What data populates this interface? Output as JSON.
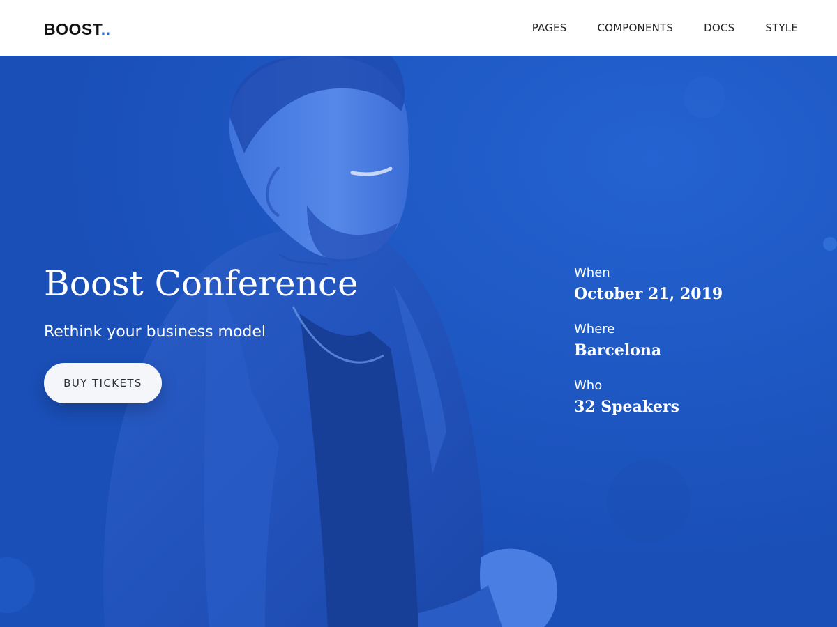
{
  "brand": {
    "name": "BOOST",
    "dots": ".."
  },
  "nav": {
    "items": [
      {
        "label": "PAGES"
      },
      {
        "label": "COMPONENTS"
      },
      {
        "label": "DOCS"
      },
      {
        "label": "STYLE"
      }
    ]
  },
  "hero": {
    "title": "Boost Conference",
    "subtitle": "Rethink your business model",
    "cta_label": "BUY TICKETS",
    "overlay_color": "#1d56c4"
  },
  "event_details": [
    {
      "label": "When",
      "value": "October 21, 2019"
    },
    {
      "label": "Where",
      "value": "Barcelona"
    },
    {
      "label": "Who",
      "value": "32 Speakers"
    }
  ],
  "colors": {
    "accent": "#1e6fd9",
    "hero_blue": "#1d56c4",
    "button_bg": "#f4f6fa"
  }
}
